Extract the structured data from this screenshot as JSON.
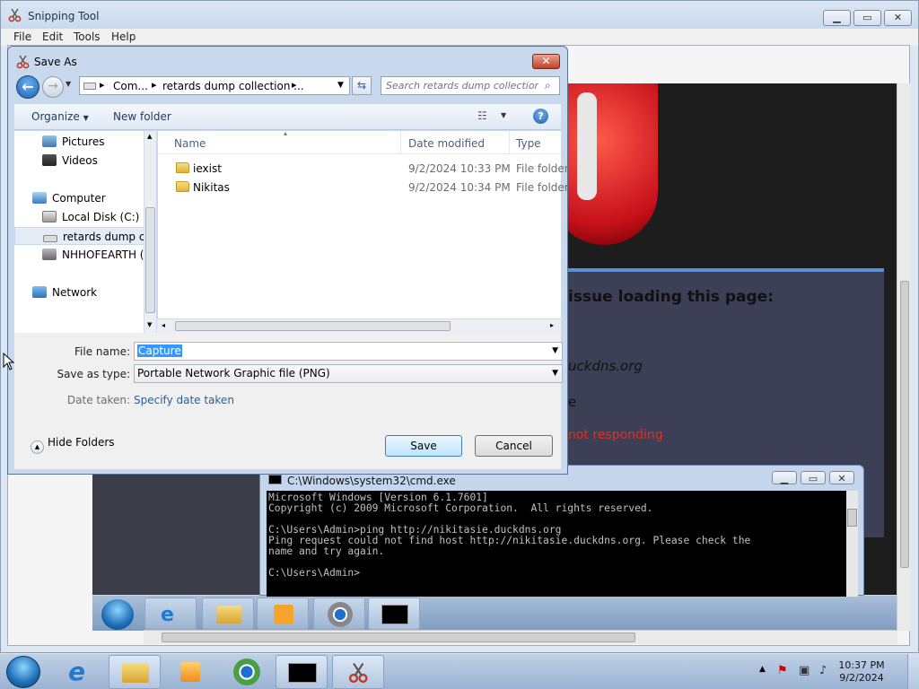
{
  "snipping_tool": {
    "title": "Snipping Tool",
    "menu": [
      "File",
      "Edit",
      "Tools",
      "Help"
    ],
    "window_controls": {
      "minimize": "▭",
      "maximize": "▭",
      "close": "✕"
    }
  },
  "captured": {
    "heading": "issue loading this page:",
    "line1": "uckdns.org",
    "line2": "e",
    "error_line": "not responding"
  },
  "cmd": {
    "title": "C:\\Windows\\system32\\cmd.exe",
    "lines": [
      "Microsoft Windows [Version 6.1.7601]",
      "Copyright (c) 2009 Microsoft Corporation.  All rights reserved.",
      "",
      "C:\\Users\\Admin>ping http://nikitasie.duckdns.org",
      "Ping request could not find host http://nikitasie.duckdns.org. Please check the",
      "name and try again.",
      "",
      "C:\\Users\\Admin>"
    ]
  },
  "save_as": {
    "title": "Save As",
    "breadcrumb": [
      "Com...",
      "retards dump collection ..."
    ],
    "search_placeholder": "Search retards dump collection...",
    "toolbar": {
      "organize": "Organize",
      "new_folder": "New folder"
    },
    "nav": {
      "pictures": "Pictures",
      "videos": "Videos",
      "computer": "Computer",
      "local_disk": "Local Disk (C:)",
      "retards_dump": "retards dump collection",
      "nhhofearth": "NHHOFEARTH (I",
      "network": "Network"
    },
    "columns": {
      "name": "Name",
      "date_modified": "Date modified",
      "type": "Type"
    },
    "files": [
      {
        "name": "iexist",
        "date": "9/2/2024 10:33 PM",
        "type": "File folder"
      },
      {
        "name": "Nikitas",
        "date": "9/2/2024 10:34 PM",
        "type": "File folder"
      }
    ],
    "file_name_label": "File name:",
    "file_name_value": "Capture",
    "save_as_type_label": "Save as type:",
    "save_as_type_value": "Portable Network Graphic file (PNG)",
    "date_taken_label": "Date taken:",
    "date_taken_link": "Specify date taken",
    "hide_folders": "Hide Folders",
    "save": "Save",
    "cancel": "Cancel"
  },
  "taskbar": {
    "time": "10:37 PM",
    "date": "9/2/2024"
  },
  "colors": {
    "accent": "#3c7fb1",
    "captured_error": "#e03020",
    "link": "#1f5fa8"
  }
}
